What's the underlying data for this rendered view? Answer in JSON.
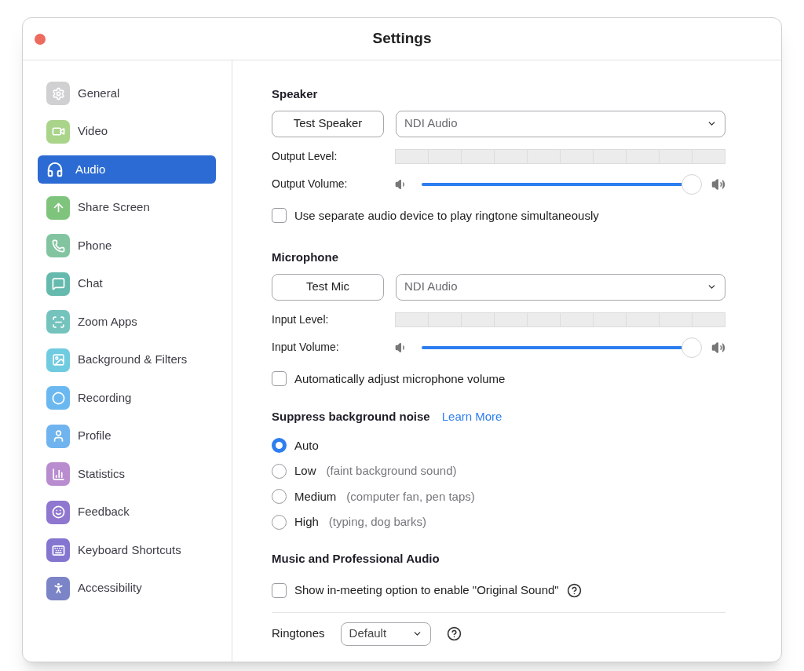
{
  "window": {
    "title": "Settings"
  },
  "sidebar": {
    "items": [
      {
        "label": "General",
        "color": "#d0d0d3",
        "selected": false
      },
      {
        "label": "Video",
        "color": "#a9d48a",
        "selected": false
      },
      {
        "label": "Audio",
        "selected": true
      },
      {
        "label": "Share Screen",
        "color": "#7fc47c",
        "selected": false
      },
      {
        "label": "Phone",
        "color": "#83c4a0",
        "selected": false
      },
      {
        "label": "Chat",
        "color": "#65b9ad",
        "selected": false
      },
      {
        "label": "Zoom Apps",
        "color": "#74c4bd",
        "selected": false
      },
      {
        "label": "Background & Filters",
        "color": "#6fcbe0",
        "selected": false
      },
      {
        "label": "Recording",
        "color": "#6ab8ef",
        "selected": false
      },
      {
        "label": "Profile",
        "color": "#6fb4ee",
        "selected": false
      },
      {
        "label": "Statistics",
        "color": "#b98ccf",
        "selected": false
      },
      {
        "label": "Feedback",
        "color": "#8f76cf",
        "selected": false
      },
      {
        "label": "Keyboard Shortcuts",
        "color": "#8476d0",
        "selected": false
      },
      {
        "label": "Accessibility",
        "color": "#7b84c7",
        "selected": false
      }
    ]
  },
  "speaker": {
    "heading": "Speaker",
    "test_button": "Test Speaker",
    "device": "NDI Audio",
    "level_label": "Output Level:",
    "volume_label": "Output Volume:",
    "volume": {
      "level": 0.98
    },
    "option": {
      "label": "Use separate audio device to play ringtone simultaneously",
      "checked": false
    }
  },
  "microphone": {
    "heading": "Microphone",
    "test_button": "Test Mic",
    "device": "NDI Audio",
    "level_label": "Input Level:",
    "volume_label": "Input Volume:",
    "volume": {
      "level": 0.98
    },
    "option": {
      "label": "Automatically adjust microphone volume",
      "checked": false
    }
  },
  "noise": {
    "heading": "Suppress background noise",
    "link": "Learn More",
    "options": [
      {
        "label": "Auto",
        "selected": true
      },
      {
        "label": "Low",
        "hint": "(faint background sound)",
        "selected": false
      },
      {
        "label": "Medium",
        "hint": "(computer fan, pen taps)",
        "selected": false
      },
      {
        "label": "High",
        "hint": "(typing, dog barks)",
        "selected": false
      }
    ]
  },
  "music": {
    "heading": "Music and Professional Audio",
    "option": {
      "label": "Show in-meeting option to enable \"Original Sound\"",
      "checked": false
    }
  },
  "ringtones": {
    "label": "Ringtones",
    "value": "Default"
  }
}
